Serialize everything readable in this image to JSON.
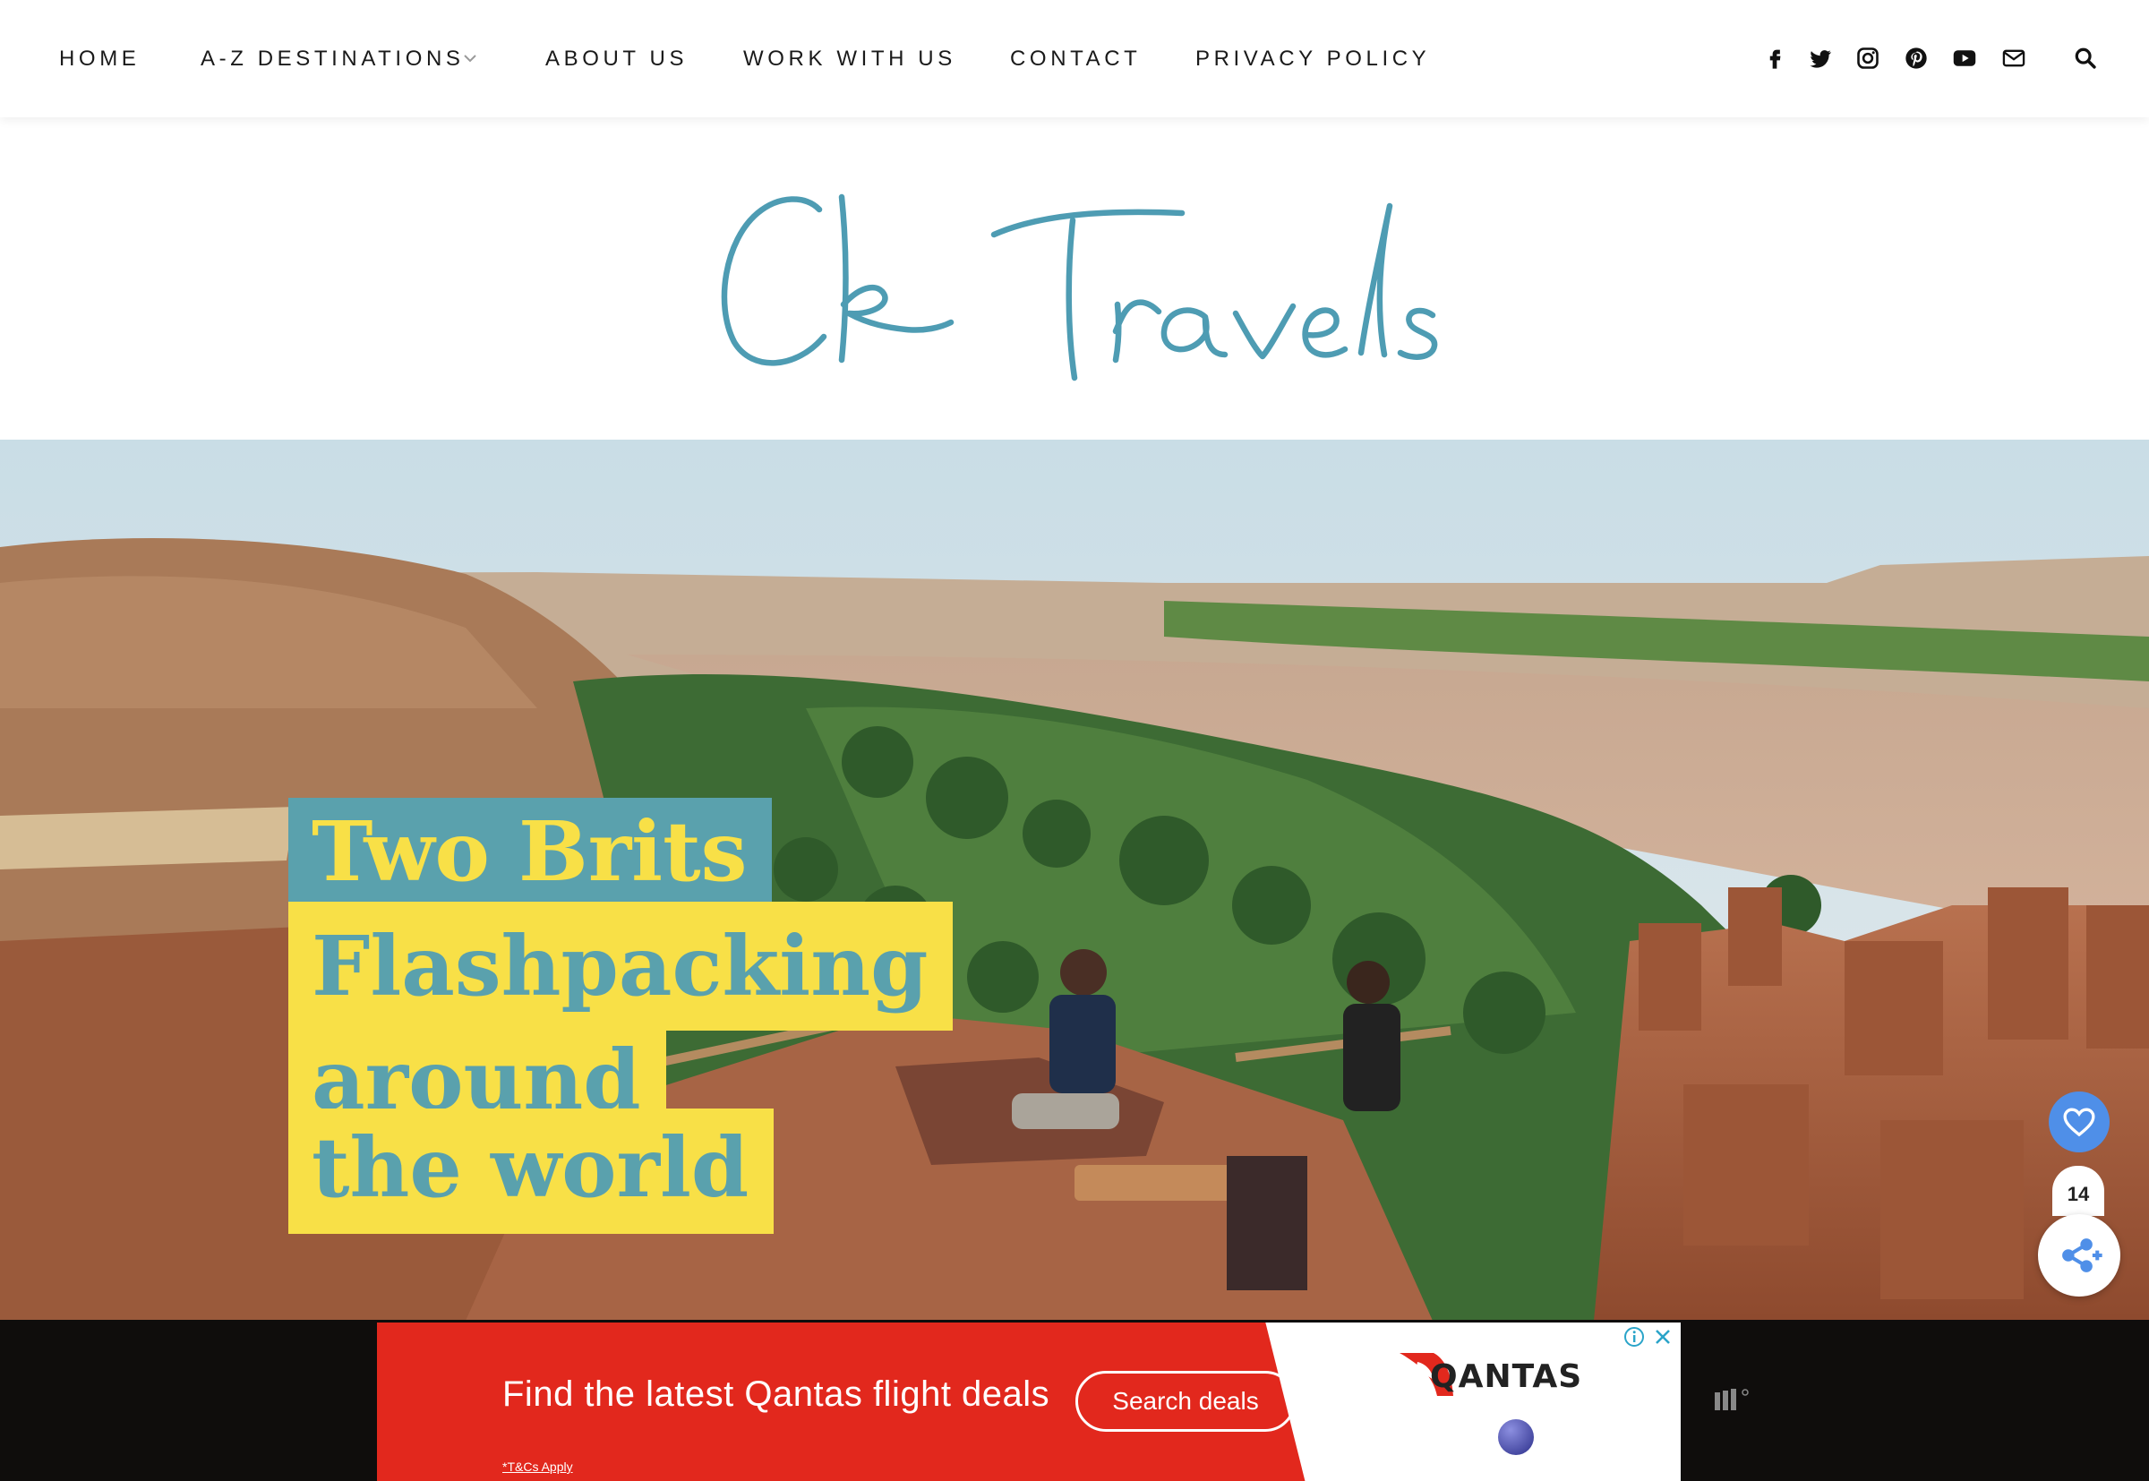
{
  "nav": {
    "items": [
      "HOME",
      "A-Z DESTINATIONS",
      "ABOUT US",
      "WORK WITH US",
      "CONTACT",
      "PRIVACY POLICY"
    ],
    "social_icons": [
      "facebook-icon",
      "twitter-icon",
      "instagram-icon",
      "pinterest-icon",
      "youtube-icon",
      "email-icon"
    ],
    "search_icon": "search-icon"
  },
  "header": {
    "logo_text": "Ck Travels",
    "logo_color": "#4e9cb3"
  },
  "hero": {
    "tagline": [
      "Two Brits",
      "Flashpacking",
      "around",
      "the world"
    ],
    "tag_colors": {
      "teal": "#5aa1ad",
      "yellow": "#f8e047"
    }
  },
  "floating": {
    "like_icon": "heart-icon",
    "share_count": "14",
    "share_icon": "share-icon"
  },
  "ad": {
    "headline": "Find the latest Qantas flight deals",
    "cta": "Search deals",
    "terms": "*T&Cs Apply",
    "brand": "QANTAS",
    "brand_color": "#e2281d"
  }
}
